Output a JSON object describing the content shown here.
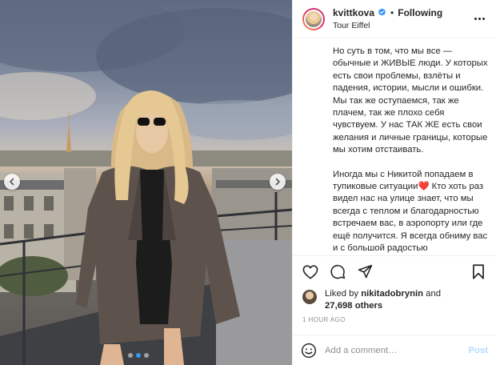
{
  "post": {
    "username": "kvittkova",
    "follow_status": "Following",
    "separator": "•",
    "location": "Tour Eiffel",
    "caption_p1": "Но суть в том, что мы все — обычные и ЖИВЫЕ люди. У которых есть свои проблемы, взлёты и падения, истории, мысли и ошибки. Мы так же оступаемся, так же плачем, так же плохо себя чувствуем. У нас ТАК ЖЕ есть свои желания и личные границы, которые мы хотим отстаивать.",
    "caption_p2_a": "Иногда мы с Никитой попадаем в тупиковые ситуации",
    "caption_emoji": "❤️",
    "caption_p2_b": " Кто хоть раз видел нас на улице знает, что мы всегда с теплом и благодарностью встречаем вас, в аэропорту или где ещё получится. Я всегда обниму вас и с большой радостью сфотографируюсь.",
    "liked_by_prefix": "Liked by ",
    "liked_by_user": "nikitadobrynin",
    "liked_by_and": " and",
    "likes_count": "27,698 others",
    "timestamp": "1 HOUR AGO",
    "comment_placeholder": "Add a comment…",
    "post_button": "Post"
  },
  "icons": {
    "verified": "verified-badge-icon",
    "more": "more-options-icon",
    "like": "heart-icon",
    "comment": "comment-icon",
    "share": "paper-plane-icon",
    "save": "bookmark-icon",
    "emoji": "smiley-icon",
    "prev": "chevron-left-icon",
    "next": "chevron-right-icon"
  },
  "carousel": {
    "slides": 3,
    "active": 1
  },
  "colors": {
    "accent": "#3897f0",
    "post_disabled": "#b3dbff",
    "muted": "#8e8e8e",
    "text": "#262626"
  }
}
